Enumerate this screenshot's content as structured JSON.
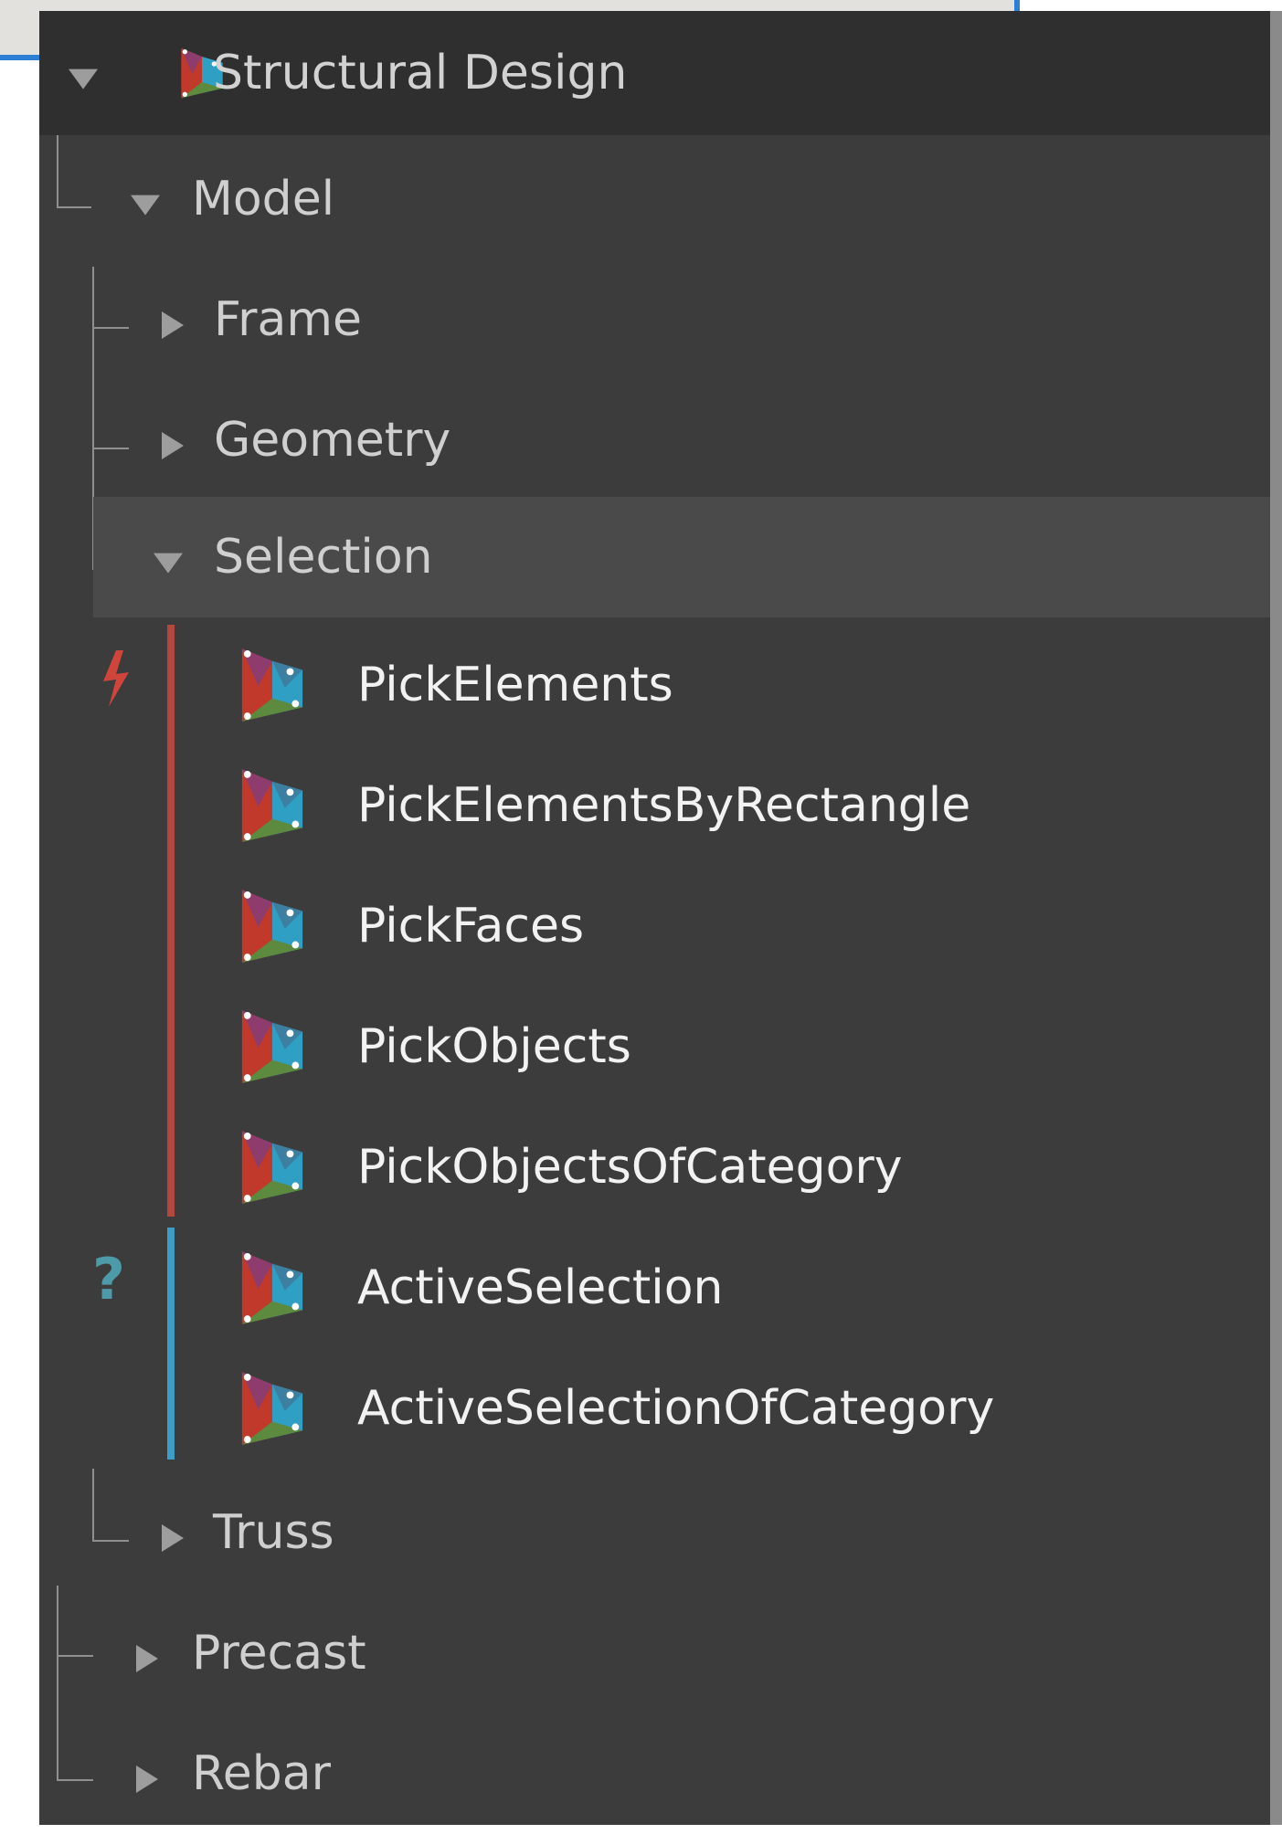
{
  "colors": {
    "panel_bg": "#3c3c3c",
    "root_bg": "#2f2f2f",
    "selected_bg": "#4a4a4a",
    "action_group": "#b4473e",
    "query_group": "#3d9dc5",
    "action_icon": "#d0453b",
    "query_icon": "#4d9aa8"
  },
  "tree": {
    "root": {
      "label": "Structural Design",
      "icon": "dynamo-package-icon",
      "expanded": true
    },
    "model": {
      "label": "Model",
      "expanded": true
    },
    "frame": {
      "label": "Frame",
      "expanded": false
    },
    "geometry": {
      "label": "Geometry",
      "expanded": false
    },
    "selection": {
      "label": "Selection",
      "expanded": true
    },
    "action_group_icon": "lightning-icon",
    "query_group_icon": "question-mark-icon",
    "query_group_symbol": "?",
    "nodes": [
      {
        "label": "PickElements",
        "group": "action"
      },
      {
        "label": "PickElementsByRectangle",
        "group": "action"
      },
      {
        "label": "PickFaces",
        "group": "action"
      },
      {
        "label": "PickObjects",
        "group": "action"
      },
      {
        "label": "PickObjectsOfCategory",
        "group": "action"
      },
      {
        "label": "ActiveSelection",
        "group": "query"
      },
      {
        "label": "ActiveSelectionOfCategory",
        "group": "query"
      }
    ],
    "truss": {
      "label": "Truss",
      "expanded": false
    },
    "precast": {
      "label": "Precast",
      "expanded": false
    },
    "rebar": {
      "label": "Rebar",
      "expanded": false
    }
  }
}
